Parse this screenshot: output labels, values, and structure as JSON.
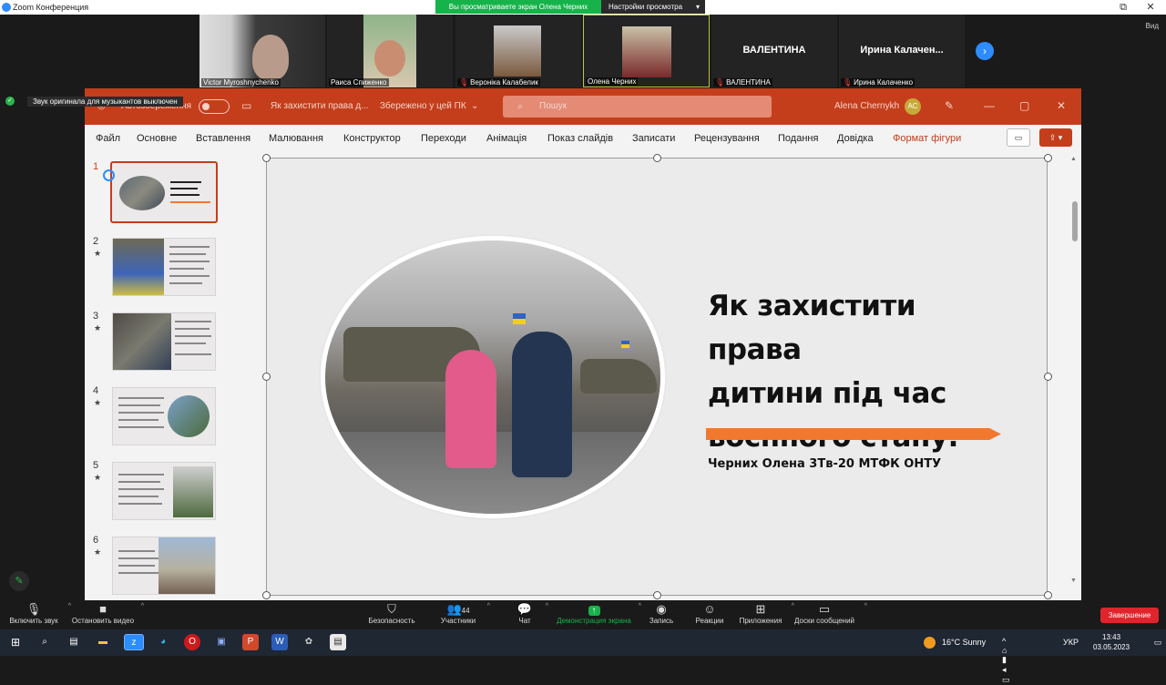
{
  "zoom": {
    "window_title": "Zoom Конференция",
    "share_banner": "Вы просматриваете экран Олена Черних",
    "view_options": "Настройки просмотра",
    "side_tag": "Вид",
    "notification": "Звук оригинала для музыкантов выключен",
    "participants": [
      {
        "name": "Victor Myroshnychenko",
        "has_video": true
      },
      {
        "name": "Раиса Спиженко",
        "has_video": true
      },
      {
        "name": "Вероніка Калабелик",
        "has_video": true
      },
      {
        "name": "Олена Черних",
        "has_video": true
      },
      {
        "name": "ВАЛЕНТИНА",
        "display_name": "ВАЛЕНТИНА",
        "has_video": false
      },
      {
        "name": "Ирина Калаченко",
        "display_name": "Ирина Калачен...",
        "has_video": false
      }
    ],
    "bottom_bar": {
      "mic": "Включить звук",
      "video": "Остановить видео",
      "security": "Безопасность",
      "participants": "Участники",
      "participants_count": "44",
      "chat": "Чат",
      "share": "Демонстрация экрана",
      "record": "Запись",
      "reactions": "Реакции",
      "apps": "Приложения",
      "whiteboard": "Доски сообщений",
      "end": "Завершение"
    }
  },
  "ppt": {
    "autosave": "Автозбереження",
    "doc_title": "Як захистити права д...",
    "saved_state": "Збережено у цей ПК",
    "search_placeholder": "Пошук",
    "user_name": "Alena Chernykh",
    "user_initials": "AC",
    "ribbon_tabs": [
      "Файл",
      "Основне",
      "Вставлення",
      "Малювання",
      "Конструктор",
      "Переходи",
      "Анімація",
      "Показ слайдів",
      "Записати",
      "Рецензування",
      "Подання",
      "Довідка",
      "Формат фігури"
    ],
    "slide_numbers": [
      "1",
      "2",
      "3",
      "4",
      "5",
      "6"
    ],
    "slide": {
      "title_lines": [
        "Як захистити права",
        "дитини під час",
        "воєнного стану."
      ],
      "subtitle": "Черних Олена 3Тв-20 МТФК ОНТУ"
    }
  },
  "taskbar": {
    "weather": "16°C Sunny",
    "lang": "УКР",
    "time": "13:43",
    "date": "03.05.2023"
  }
}
